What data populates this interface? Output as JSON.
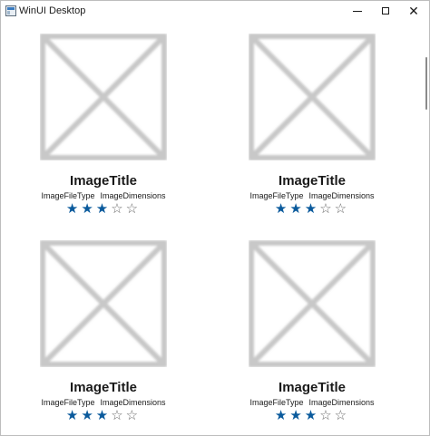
{
  "window": {
    "title": "WinUI Desktop",
    "controls": {
      "minimize_icon": "minimize-icon",
      "maximize_icon": "maximize-icon",
      "close_glyph": "✕"
    }
  },
  "colors": {
    "star_filled": "#0a5a9c",
    "star_empty": "#6a6a6a",
    "placeholder_stroke": "#c8c8c8"
  },
  "items": [
    {
      "title": "ImageTitle",
      "file_type": "ImageFileType",
      "dimensions": "ImageDimensions",
      "rating": 3,
      "max_rating": 5
    },
    {
      "title": "ImageTitle",
      "file_type": "ImageFileType",
      "dimensions": "ImageDimensions",
      "rating": 3,
      "max_rating": 5
    },
    {
      "title": "ImageTitle",
      "file_type": "ImageFileType",
      "dimensions": "ImageDimensions",
      "rating": 3,
      "max_rating": 5
    },
    {
      "title": "ImageTitle",
      "file_type": "ImageFileType",
      "dimensions": "ImageDimensions",
      "rating": 3,
      "max_rating": 5
    }
  ]
}
